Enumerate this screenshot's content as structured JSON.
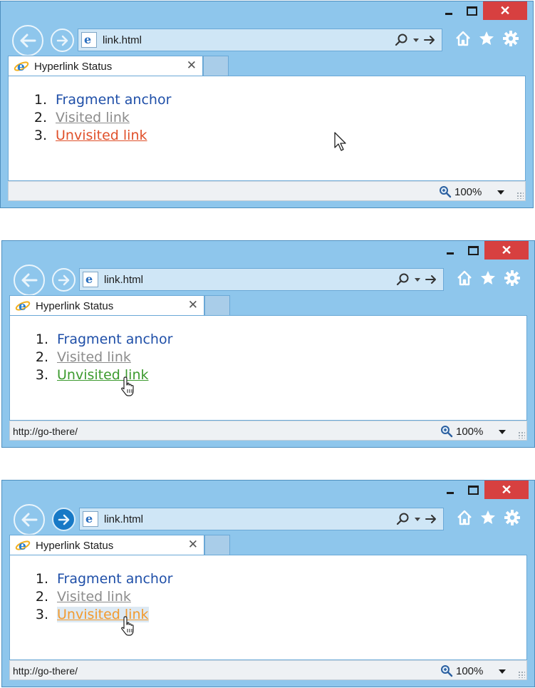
{
  "windows": [
    {
      "address_text": "link.html",
      "tab_title": "Hyperlink Status",
      "links": [
        {
          "number": "1.",
          "label": "Fragment anchor",
          "color": "#1f4fa8"
        },
        {
          "number": "2.",
          "label": "Visited link",
          "color": "#8c8c8c"
        },
        {
          "number": "3.",
          "label": "Unvisited link",
          "color": "#e0502a"
        }
      ],
      "status_url": "",
      "zoom": "100%"
    },
    {
      "address_text": "link.html",
      "tab_title": "Hyperlink Status",
      "links": [
        {
          "number": "1.",
          "label": "Fragment anchor",
          "color": "#1f4fa8"
        },
        {
          "number": "2.",
          "label": "Visited link",
          "color": "#8c8c8c"
        },
        {
          "number": "3.",
          "label": "Unvisited link",
          "color": "#3c9a2e"
        }
      ],
      "status_url": "http://go-there/",
      "zoom": "100%"
    },
    {
      "address_text": "link.html",
      "tab_title": "Hyperlink Status",
      "links": [
        {
          "number": "1.",
          "label": "Fragment anchor",
          "color": "#1f4fa8"
        },
        {
          "number": "2.",
          "label": "Visited link",
          "color": "#8c8c8c"
        },
        {
          "number": "3.",
          "label": "Unvisited link",
          "color": "#f29a2e"
        }
      ],
      "status_url": "http://go-there/",
      "zoom": "100%"
    }
  ],
  "caption_close_glyph": "✕",
  "tab_close_glyph": "✕",
  "icons": [
    "back-arrow-icon",
    "forward-arrow-icon",
    "ie-page-icon",
    "search-icon",
    "go-arrow-icon",
    "home-icon",
    "favorites-star-icon",
    "gear-icon",
    "zoom-icon",
    "arrow-cursor-icon",
    "hand-cursor-icon"
  ]
}
